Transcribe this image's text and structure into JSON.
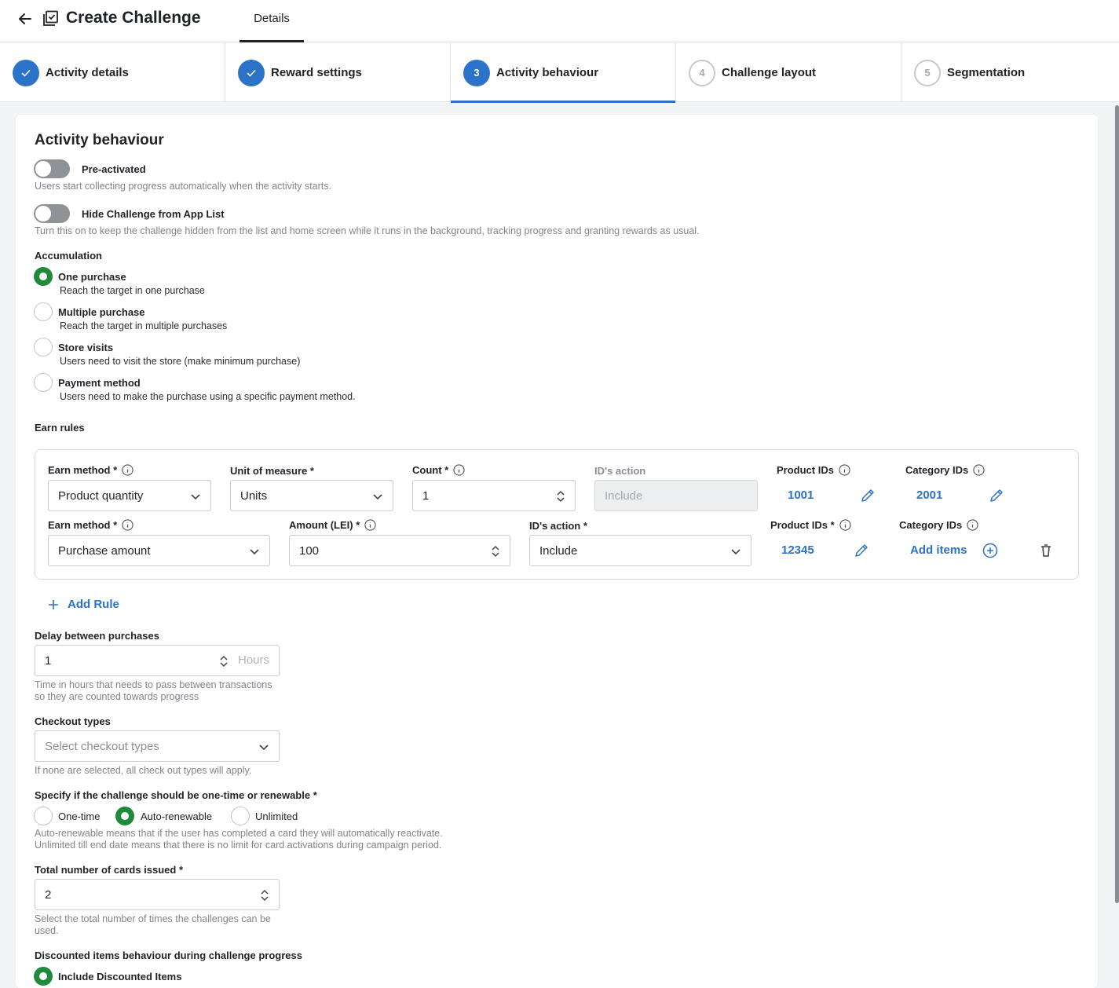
{
  "header": {
    "title": "Create Challenge",
    "tab": "Details"
  },
  "stepper": [
    {
      "label": "Activity details",
      "state": "done"
    },
    {
      "label": "Reward settings",
      "state": "done"
    },
    {
      "number": "3",
      "label": "Activity behaviour",
      "state": "current"
    },
    {
      "number": "4",
      "label": "Challenge layout",
      "state": "todo"
    },
    {
      "number": "5",
      "label": "Segmentation",
      "state": "todo"
    }
  ],
  "section_title": "Activity behaviour",
  "pre_activated": {
    "label": "Pre-activated",
    "help": "Users start collecting progress automatically when the activity starts.",
    "enabled": false
  },
  "hide_challenge": {
    "label": "Hide Challenge from App List",
    "help": "Turn this on to keep the challenge hidden from the list and home screen while it runs in the background, tracking progress and granting rewards as usual.",
    "enabled": false
  },
  "accumulation": {
    "label": "Accumulation",
    "options": [
      {
        "label": "One purchase",
        "desc": "Reach the target in one purchase",
        "selected": true
      },
      {
        "label": "Multiple purchase",
        "desc": "Reach the target in multiple purchases",
        "selected": false
      },
      {
        "label": "Store visits",
        "desc": "Users need to visit the store (make minimum purchase)",
        "selected": false
      },
      {
        "label": "Payment method",
        "desc": "Users need to make the purchase using a specific payment method.",
        "selected": false
      }
    ]
  },
  "earn_rules": {
    "label": "Earn rules",
    "rule1": {
      "earn_method_label": "Earn method *",
      "earn_method_value": "Product quantity",
      "unit_label": "Unit of measure *",
      "unit_value": "Units",
      "count_label": "Count *",
      "count_value": "1",
      "ids_action_label": "ID's action",
      "ids_action_value": "Include",
      "product_ids_label": "Product IDs",
      "product_ids_value": "1001",
      "category_ids_label": "Category IDs",
      "category_ids_value": "2001"
    },
    "rule2": {
      "earn_method_label": "Earn method *",
      "earn_method_value": "Purchase amount",
      "amount_label": "Amount (LEI) *",
      "amount_value": "100",
      "ids_action_label": "ID's action *",
      "ids_action_value": "Include",
      "product_ids_label": "Product IDs *",
      "product_ids_value": "12345",
      "category_ids_label": "Category IDs",
      "category_ids_value": "Add items"
    },
    "add_rule": "Add Rule"
  },
  "delay": {
    "label": "Delay between purchases",
    "value": "1",
    "unit": "Hours",
    "help": "Time in hours that needs to pass between transactions so they are counted towards progress"
  },
  "checkout": {
    "label": "Checkout types",
    "placeholder": "Select checkout types",
    "help": "If none are selected, all check out types will apply."
  },
  "renewal": {
    "label": "Specify if the challenge should be one-time or renewable *",
    "options": [
      {
        "label": "One-time",
        "selected": false
      },
      {
        "label": "Auto-renewable",
        "selected": true
      },
      {
        "label": "Unlimited",
        "selected": false
      }
    ],
    "help1": "Auto-renewable means that if the user has completed a card they will automatically reactivate.",
    "help2": "Unlimited till end date means that there is no limit for card activations during campaign period."
  },
  "total_cards": {
    "label": "Total number of cards issued *",
    "value": "2",
    "help": "Select the total number of times the challenges can be used."
  },
  "discounted": {
    "label": "Discounted items behaviour during challenge progress",
    "option": "Include Discounted Items",
    "selected": true
  },
  "colors": {
    "primary": "#2b72c9",
    "success": "#1f8a3a"
  }
}
